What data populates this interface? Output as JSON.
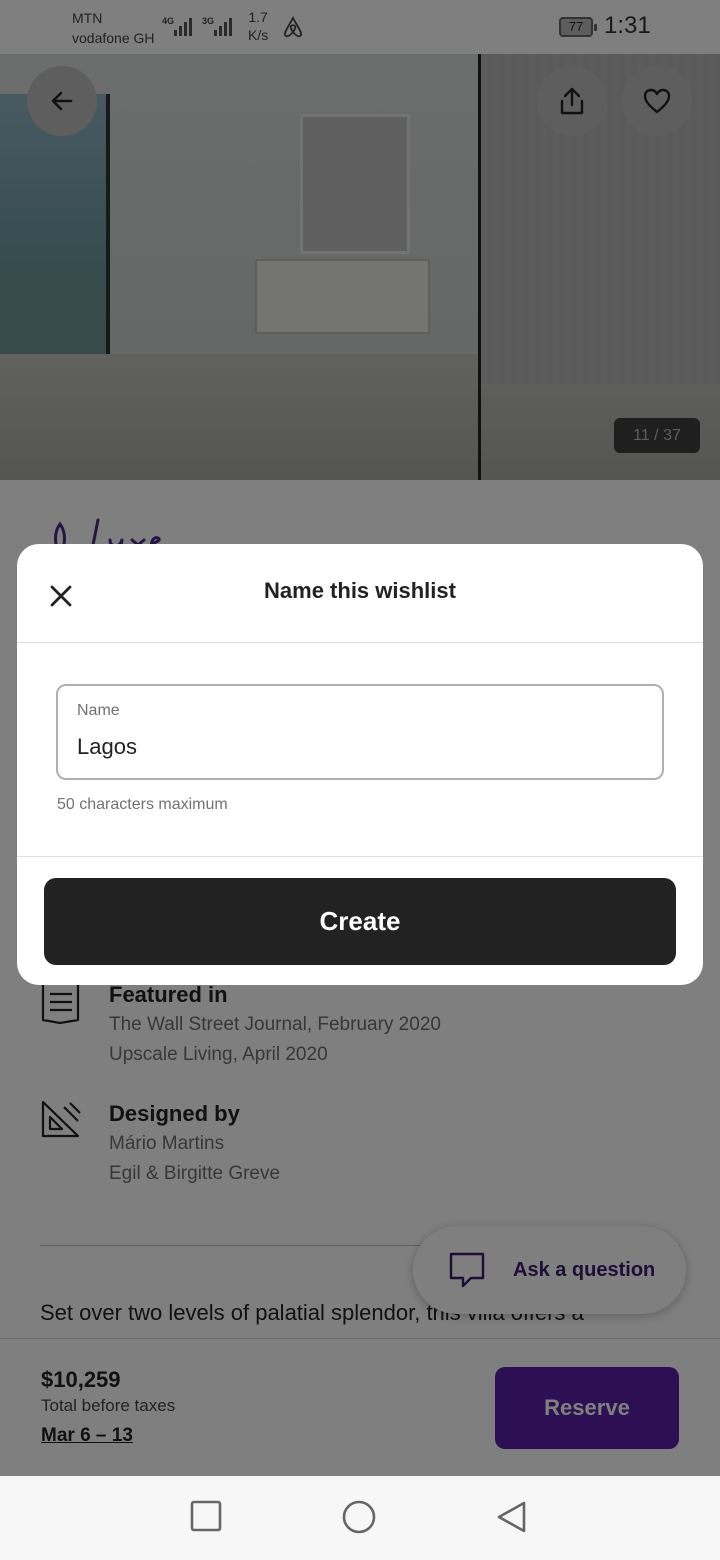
{
  "status_bar": {
    "carrier_1": "MTN",
    "carrier_2": "vodafone GH",
    "network_1": "4G",
    "network_2": "3G",
    "speed_value": "1.7",
    "speed_unit": "K/s",
    "battery": "77",
    "time": "1:31"
  },
  "gallery": {
    "counter": "11 / 37"
  },
  "listing": {
    "featured": {
      "title": "Featured in",
      "lines": [
        "The Wall Street Journal, February 2020",
        "Upscale Living, April 2020"
      ]
    },
    "designed": {
      "title": "Designed by",
      "lines": [
        "Mário Martins",
        "Egil & Birgitte Greve"
      ]
    },
    "description": "Set over two levels of palatial splendor, this villa offers a",
    "ask_label": "Ask a question"
  },
  "footer": {
    "price": "$10,259",
    "price_note": "Total before taxes",
    "dates": "Mar 6 – 13",
    "reserve_label": "Reserve"
  },
  "modal": {
    "title": "Name this wishlist",
    "field_label": "Name",
    "field_value": "Lagos",
    "hint": "50 characters maximum",
    "create_label": "Create"
  },
  "colors": {
    "accent_purple": "#5b1fa6",
    "button_dark": "#222222"
  }
}
